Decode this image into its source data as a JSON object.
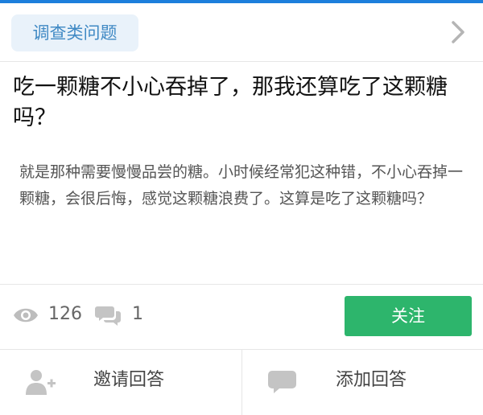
{
  "tag": {
    "label": "调查类问题"
  },
  "question": {
    "title": "吃一颗糖不小心吞掉了，那我还算吃了这颗糖吗？",
    "description": "就是那种需要慢慢品尝的糖。小时候经常犯这种错，不小心吞掉一颗糖，会很后悔，感觉这颗糖浪费了。这算是吃了这颗糖吗？"
  },
  "stats": {
    "views": "126",
    "answers": "1"
  },
  "follow_button": {
    "label": "关注",
    "color": "#2db56c"
  },
  "actions": {
    "invite_label": "邀请回答",
    "add_label": "添加回答"
  },
  "colors": {
    "top_bar": "#1d7fdc",
    "tag_bg": "#e9f2fa",
    "tag_text": "#3f89c4"
  },
  "icons": [
    "chevron-right-icon",
    "eye-icon",
    "comment-icon",
    "invite-user-icon",
    "add-answer-icon"
  ]
}
